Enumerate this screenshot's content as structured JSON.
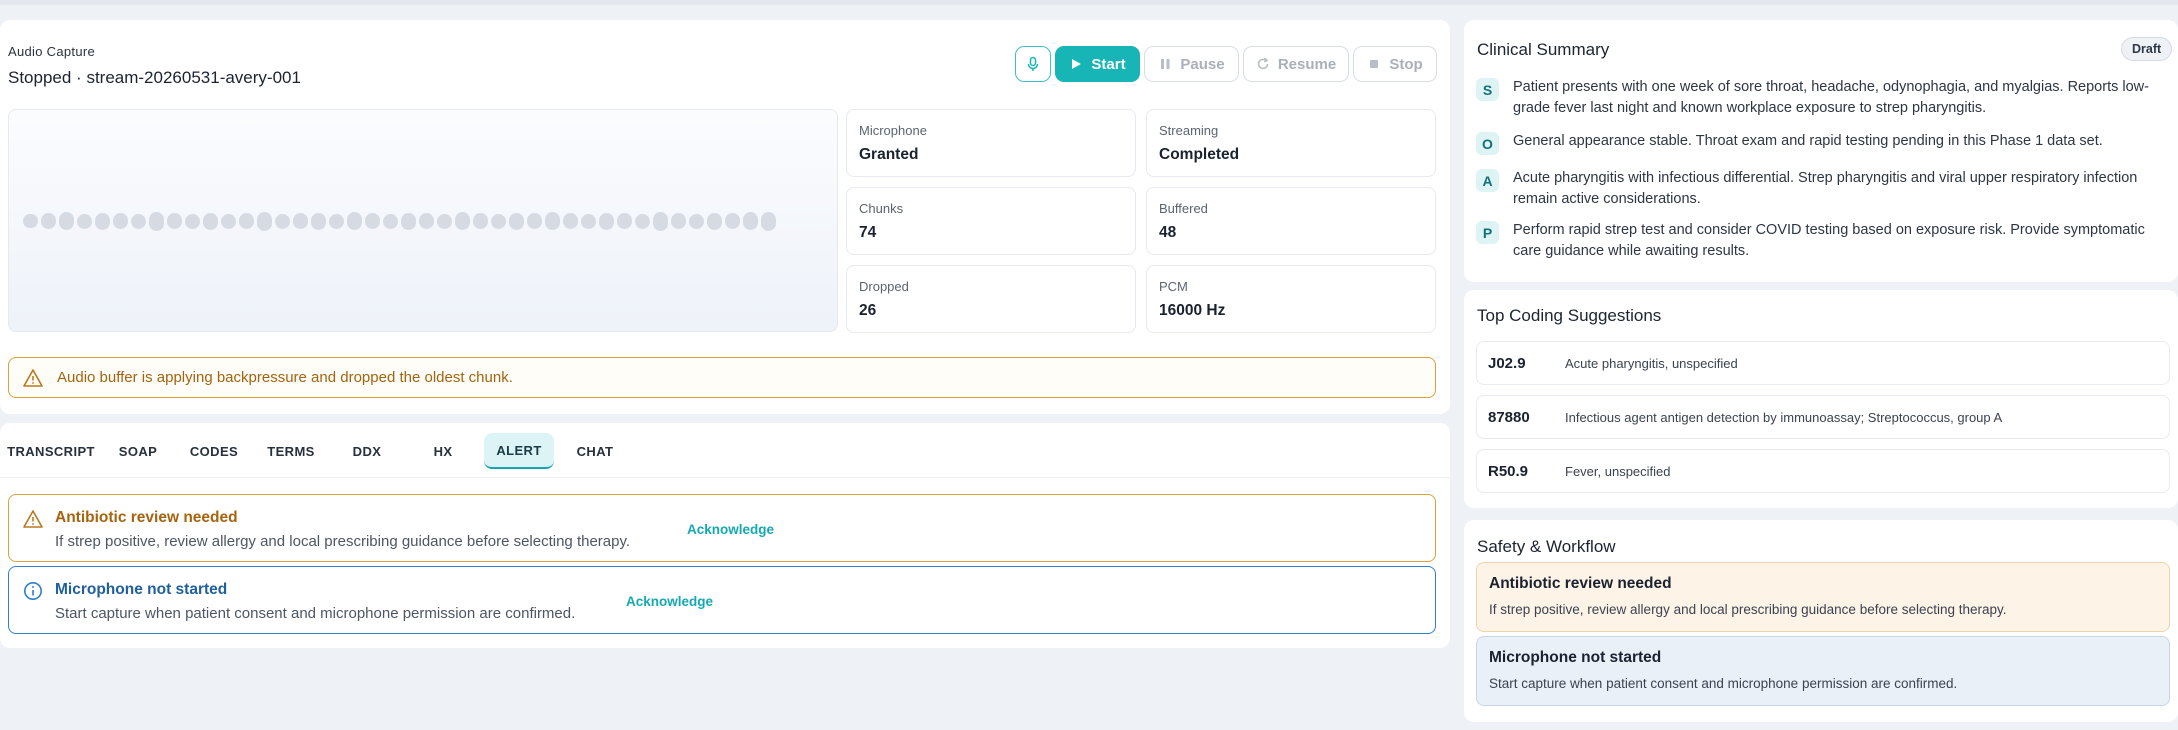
{
  "capture": {
    "section_label": "Audio Capture",
    "status_line": "Stopped · stream-20260531-avery-001",
    "buttons": {
      "start": "Start",
      "pause": "Pause",
      "resume": "Resume",
      "stop": "Stop"
    },
    "stats": [
      {
        "label": "Microphone",
        "value": "Granted"
      },
      {
        "label": "Streaming",
        "value": "Completed"
      },
      {
        "label": "Chunks",
        "value": "74"
      },
      {
        "label": "Buffered",
        "value": "48"
      },
      {
        "label": "Dropped",
        "value": "26"
      },
      {
        "label": "PCM",
        "value": "16000 Hz"
      }
    ],
    "warning": "Audio buffer is applying backpressure and dropped the oldest chunk."
  },
  "tabs": [
    {
      "label": "TRANSCRIPT"
    },
    {
      "label": "SOAP"
    },
    {
      "label": "CODES"
    },
    {
      "label": "TERMS"
    },
    {
      "label": "DDX"
    },
    {
      "label": "HX"
    },
    {
      "label": "ALERT"
    },
    {
      "label": "CHAT"
    }
  ],
  "active_tab": "ALERT",
  "alerts": [
    {
      "title": "Antibiotic review needed",
      "text": "If strep positive, review allergy and local prescribing guidance before selecting therapy.",
      "action": "Acknowledge",
      "level": "warning",
      "color": "#d9a23d"
    },
    {
      "title": "Microphone not started",
      "text": "Start capture when patient consent and microphone permission are confirmed.",
      "action": "Acknowledge",
      "level": "info",
      "color": "#2f7fc9"
    }
  ],
  "summary": {
    "title": "Clinical Summary",
    "badge": "Draft",
    "soap": [
      {
        "letter": "S",
        "text": "Patient presents with one week of sore throat, headache, odynophagia, and myalgias. Reports low-grade fever last night and known workplace exposure to strep pharyngitis."
      },
      {
        "letter": "O",
        "text": "General appearance stable. Throat exam and rapid testing pending in this Phase 1 data set."
      },
      {
        "letter": "A",
        "text": "Acute pharyngitis with infectious differential. Strep pharyngitis and viral upper respiratory infection remain active considerations."
      },
      {
        "letter": "P",
        "text": "Perform rapid strep test and consider COVID testing based on exposure risk. Provide symptomatic care guidance while awaiting results."
      }
    ]
  },
  "coding": {
    "title": "Top Coding Suggestions",
    "items": [
      {
        "code": "J02.9",
        "desc": "Acute pharyngitis, unspecified"
      },
      {
        "code": "87880",
        "desc": "Infectious agent antigen detection by immunoassay; Streptococcus, group A"
      },
      {
        "code": "R50.9",
        "desc": "Fever, unspecified"
      }
    ]
  },
  "safety": {
    "title": "Safety & Workflow",
    "items": [
      {
        "title": "Antibiotic review needed",
        "text": "If strep positive, review allergy and local prescribing guidance before selecting therapy.",
        "bg": "#fdf3e7",
        "border": "#f1d3a8"
      },
      {
        "title": "Microphone not started",
        "text": "Start capture when patient consent and microphone permission are confirmed.",
        "bg": "#eaf0f8",
        "border": "#c9d5e6"
      }
    ]
  },
  "colors": {
    "accent": "#17b5b6",
    "warning": "#d9a23d",
    "info": "#2f7fc9"
  }
}
